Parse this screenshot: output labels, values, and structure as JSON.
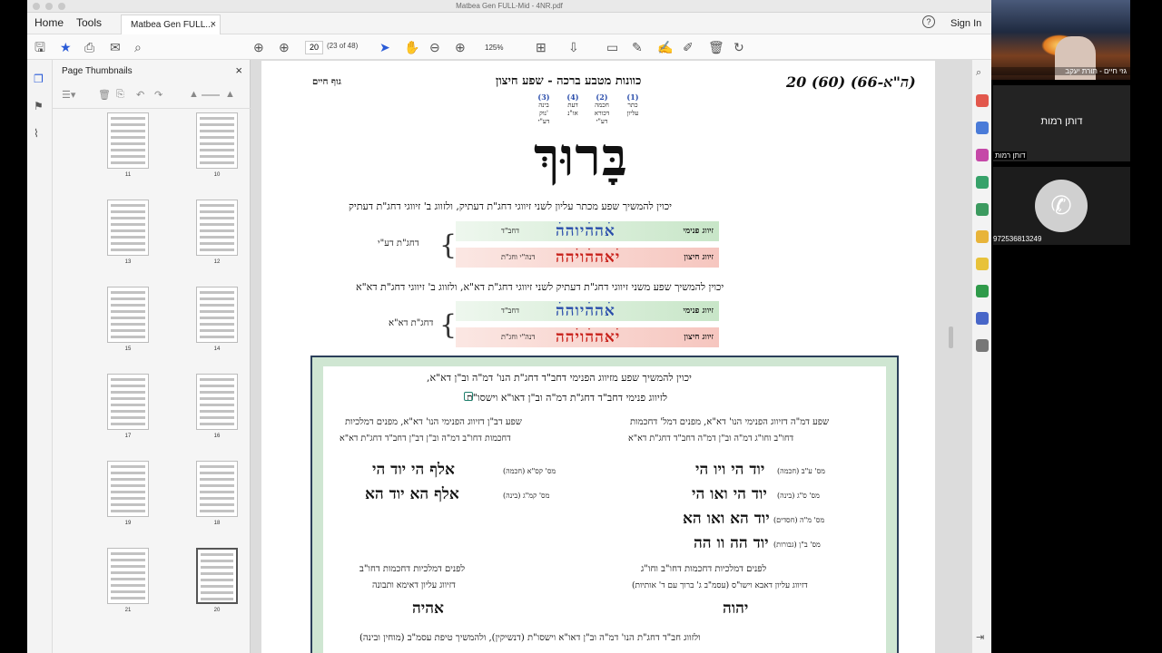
{
  "window": {
    "title": "Matbea Gen FULL-Mid - 4NR.pdf"
  },
  "menubar": {
    "home": "Home",
    "tools": "Tools",
    "doc_tab": "Matbea Gen FULL...",
    "close": "×",
    "help": "?",
    "signin": "Sign In"
  },
  "toolbar": {
    "page_input": "20",
    "page_of": "(23 of 48)",
    "zoom": "125%"
  },
  "thumbs": {
    "title": "Page Thumbnails",
    "close": "×",
    "items": [
      {
        "label": "11"
      },
      {
        "label": "10"
      },
      {
        "label": "13"
      },
      {
        "label": "12"
      },
      {
        "label": "15"
      },
      {
        "label": "14"
      },
      {
        "label": "17"
      },
      {
        "label": "16"
      },
      {
        "label": "19"
      },
      {
        "label": "18"
      },
      {
        "label": "21"
      },
      {
        "label": "20"
      }
    ]
  },
  "page": {
    "number": "(ה\"א-66) (60) 20",
    "title": "כוונות מטבע ברכה - שפע חיצון",
    "right_heading": "גוף חיים",
    "columns": [
      {
        "num": "(3)",
        "l1": "בינה",
        "l2": "נוק'",
        "l3": "דע\"י"
      },
      {
        "num": "(2)",
        "l1": "חכמה",
        "l2": "דכורא",
        "l3": "דע\"י"
      },
      {
        "num": "(4)",
        "l1": "דעת",
        "l2": "או\"נ",
        "l3": ""
      },
      {
        "num": "(1)",
        "l1": "כתר",
        "l2": "עליון",
        "l3": ""
      }
    ],
    "big_word": "בָּרוּךְ",
    "line1": "יכוין להמשיך שפע מכתר עליון לשני זיווגי דחג\"ת דעתיק, ולזווג ב' זיווגי דחג\"ת דעתיק",
    "line2": "יכוין להמשיך שפע משני זיווגי דחג\"ת דעתיק לשני זיווגי דחג\"ת דא\"א, ולזווג ב' זיווגי דחג\"ת דא\"א",
    "rows": [
      {
        "label": "זיווג פנימי",
        "name": "אׄההׄיוההׄ",
        "suffix": "דחב\"ד"
      },
      {
        "label": "זיווג חיצון",
        "name": "יׄאההׄויׄהה",
        "suffix": "דנה\"י וחג\"ת"
      },
      {
        "label": "זיווג פנימי",
        "name": "אׄההׄיוההׄ",
        "suffix": "דחב\"ד"
      },
      {
        "label": "זיווג חיצון",
        "name": "יׄאההׄויׄהה",
        "suffix": "דנה\"י וחג\"ת"
      }
    ],
    "brace1_label": "דחג\"ת דע\"י",
    "brace2_label": "דחג\"ת דא\"א",
    "box": {
      "intro1": "יכוין להמשיך שפע מזיווג הפנימי דחב\"ד דחג\"ת הנו' דמ\"ה וב\"ן דא\"א,",
      "intro2": "לזיווג פנימי דחב\"ד דחג\"ת דמ\"ה וב\"ן דאו\"א וישסו\"ת",
      "r_head1": "שפע דמ\"ה דזיווג הפנימי הנו' דא\"א, מפנים דמל' דחכמות",
      "r_head2": "דחו\"ב וחו\"ג דמ\"ה וב\"ן דמ\"ה דחב\"ד דחג\"ת דא\"א",
      "l_head1": "שפע דב\"ן דזיווג הפנימי הנו' דא\"א, מפנים דמלכיות",
      "l_head2": "דחכמות דחו\"ב דמ\"ה וב\"ן דב\"ן דחב\"ד דחג\"ת דא\"א",
      "r_lines": [
        {
          "pre": "מס' ע\"ב (חכמה)",
          "txt": "יוד הי ויו הי"
        },
        {
          "pre": "מס' ס\"ג (בינה)",
          "txt": "יוד הי ואו הי"
        },
        {
          "pre": "מס' מ\"ה (חסדים)",
          "txt": "יוד הא ואו הא"
        },
        {
          "pre": "מס' ב\"ן (גבורות)",
          "txt": "יוד הה וו הה"
        }
      ],
      "l_lines": [
        {
          "pre": "מס' קס\"א (חכמה)",
          "txt": "אלף הי יוד הי"
        },
        {
          "pre": "מס' קמ\"ג (בינה)",
          "txt": "אלף הא יוד הא"
        }
      ],
      "r_foot1": "לפנים דמלכיות דחכמות דחו\"ב וחו\"ג",
      "r_foot2": "דזיווג עליון דאבא וישו\"ס (עסמ\"ב ג' ברוך עם ד' אותיות)",
      "r_name": "יהוה",
      "l_foot1": "לפנים דמלכיות דחכמות דחו\"ב",
      "l_foot2": "דזיווג עליון דאימא ותבונה",
      "l_name": "אהיה",
      "bottom": "ולזווג חב\"ד דחג\"ת הנו' דמ\"ה וב\"ן דאו\"א וישסו\"ת (דנשיקין), ולהמשיך טיפת עסמ\"ב (מוחין ובינה)"
    }
  },
  "zoom_panel": {
    "cam_name": "גזי חיים - תורת יעקב",
    "tile2_name": "דותן רמות",
    "tile2_small": "דותן רמות",
    "tile3_number": "972536813249"
  },
  "colors": {
    "blue_name": "#2a4dab",
    "red_name": "#c8201a",
    "green_row": "#c8e6c8",
    "red_row": "#f6c6bf"
  }
}
